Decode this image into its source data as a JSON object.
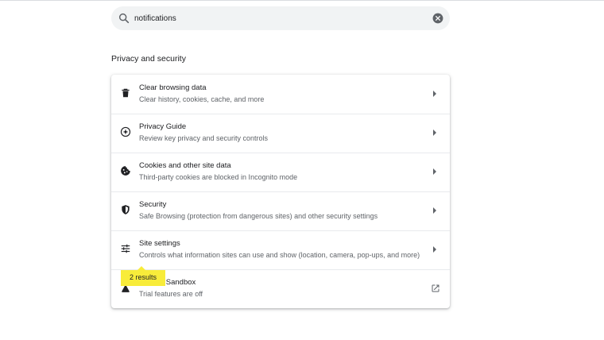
{
  "search": {
    "value": "notifications",
    "icon": "search-icon",
    "clear_icon": "clear-icon"
  },
  "section": {
    "title": "Privacy and security"
  },
  "rows": [
    {
      "title": "Clear browsing data",
      "subtitle": "Clear history, cookies, cache, and more",
      "icon": "trash-icon",
      "trailing": "chevron-right-icon"
    },
    {
      "title": "Privacy Guide",
      "subtitle": "Review key privacy and security controls",
      "icon": "compass-icon",
      "trailing": "chevron-right-icon"
    },
    {
      "title": "Cookies and other site data",
      "subtitle": "Third-party cookies are blocked in Incognito mode",
      "icon": "cookie-icon",
      "trailing": "chevron-right-icon"
    },
    {
      "title": "Security",
      "subtitle": "Safe Browsing (protection from dangerous sites) and other security settings",
      "icon": "shield-icon",
      "trailing": "chevron-right-icon"
    },
    {
      "title": "Site settings",
      "subtitle": "Controls what information sites can use and show (location, camera, pop-ups, and more)",
      "icon": "tune-icon",
      "trailing": "chevron-right-icon"
    },
    {
      "title": "Privacy Sandbox",
      "subtitle": "Trial features are off",
      "icon": "flask-icon",
      "trailing": "external-link-icon"
    }
  ],
  "tooltip": {
    "text": "2 results"
  },
  "colors": {
    "search_bg": "#f1f3f4",
    "highlight": "#f8ec3a",
    "text_primary": "#202124",
    "text_secondary": "#5f6368"
  }
}
